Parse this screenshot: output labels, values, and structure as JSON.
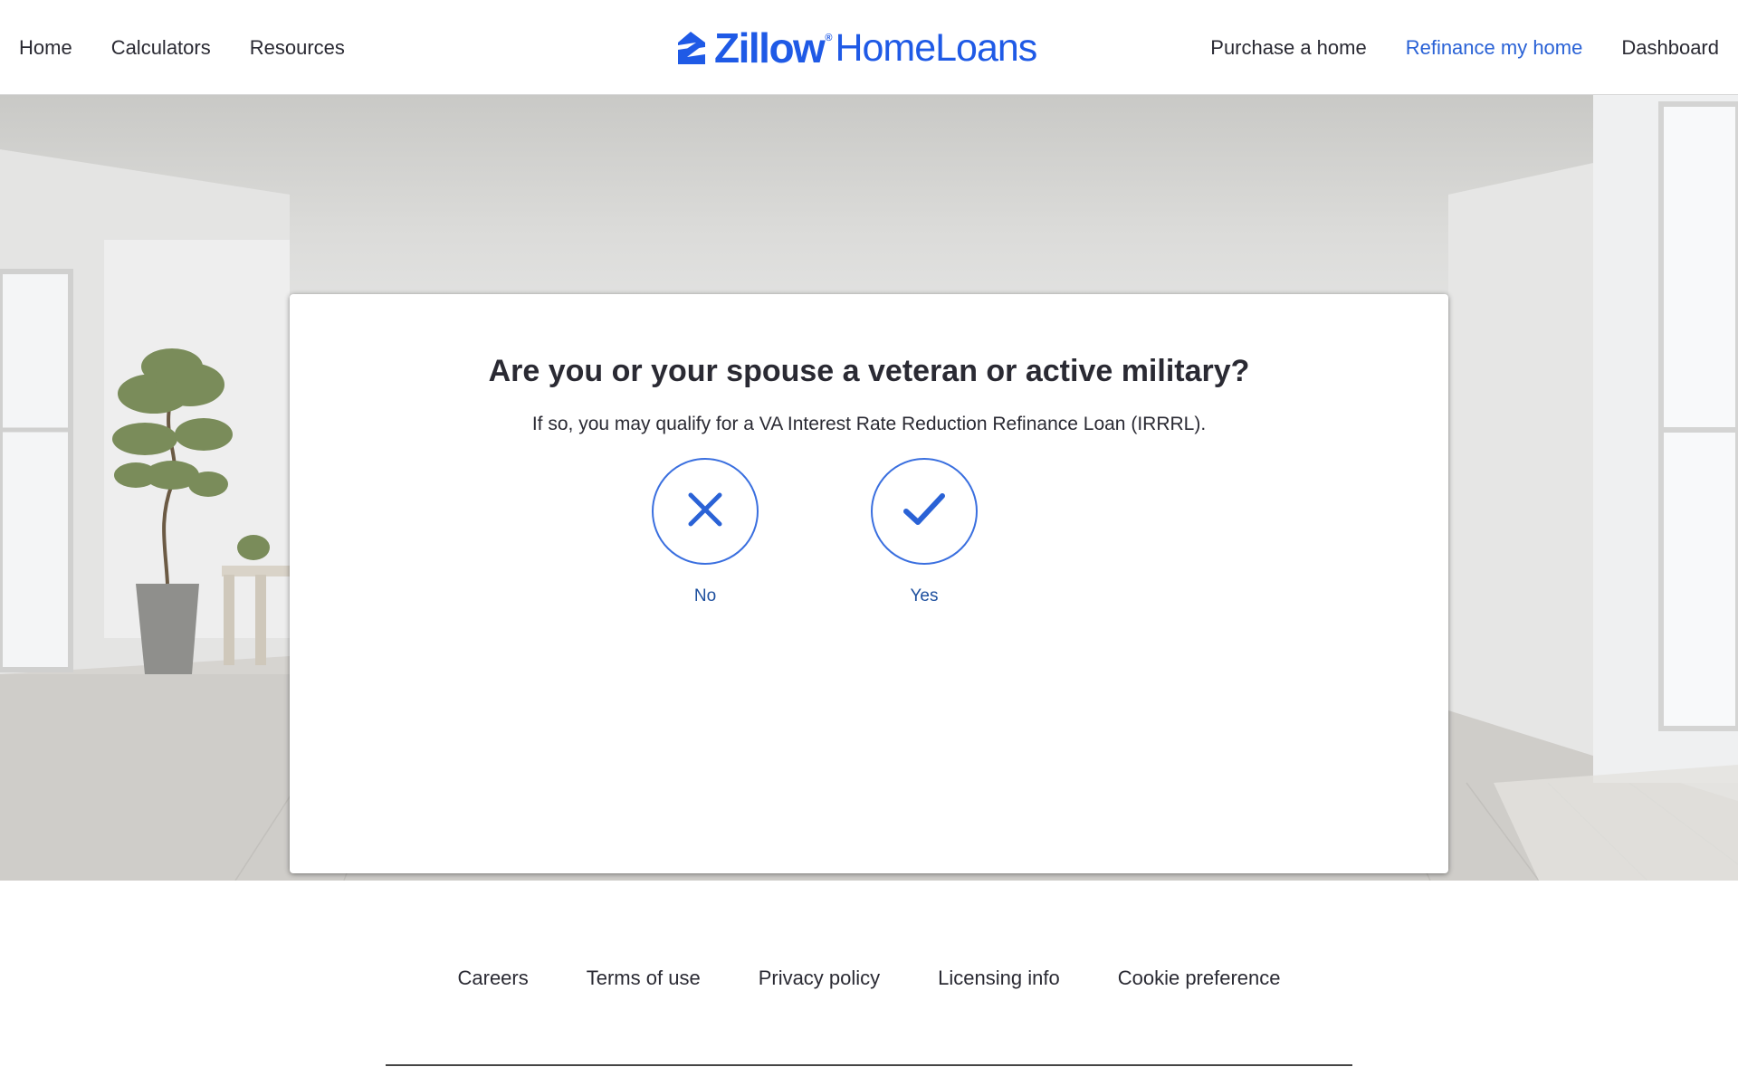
{
  "header": {
    "nav_left": [
      {
        "label": "Home"
      },
      {
        "label": "Calculators"
      },
      {
        "label": "Resources"
      }
    ],
    "logo": {
      "brand": "Zillow",
      "registered": "®",
      "product": "HomeLoans",
      "icon": "zillow-house-logo-icon"
    },
    "nav_right": [
      {
        "label": "Purchase a home"
      },
      {
        "label": "Refinance my home"
      },
      {
        "label": "Dashboard"
      }
    ]
  },
  "card": {
    "title": "Are you or your spouse a veteran or active military?",
    "subtitle": "If so, you may qualify for a VA Interest Rate Reduction Refinance Loan (IRRRL).",
    "options": [
      {
        "label": "No",
        "icon": "x-icon"
      },
      {
        "label": "Yes",
        "icon": "checkmark-icon"
      }
    ]
  },
  "footer": {
    "links": [
      {
        "label": "Careers"
      },
      {
        "label": "Terms of use"
      },
      {
        "label": "Privacy policy"
      },
      {
        "label": "Licensing info"
      },
      {
        "label": "Cookie preference"
      }
    ]
  },
  "colors": {
    "brand_blue": "#1f5ae6",
    "active_nav": "#2a62d6",
    "text": "#2a2a33",
    "option_label": "#1d4f9e"
  }
}
